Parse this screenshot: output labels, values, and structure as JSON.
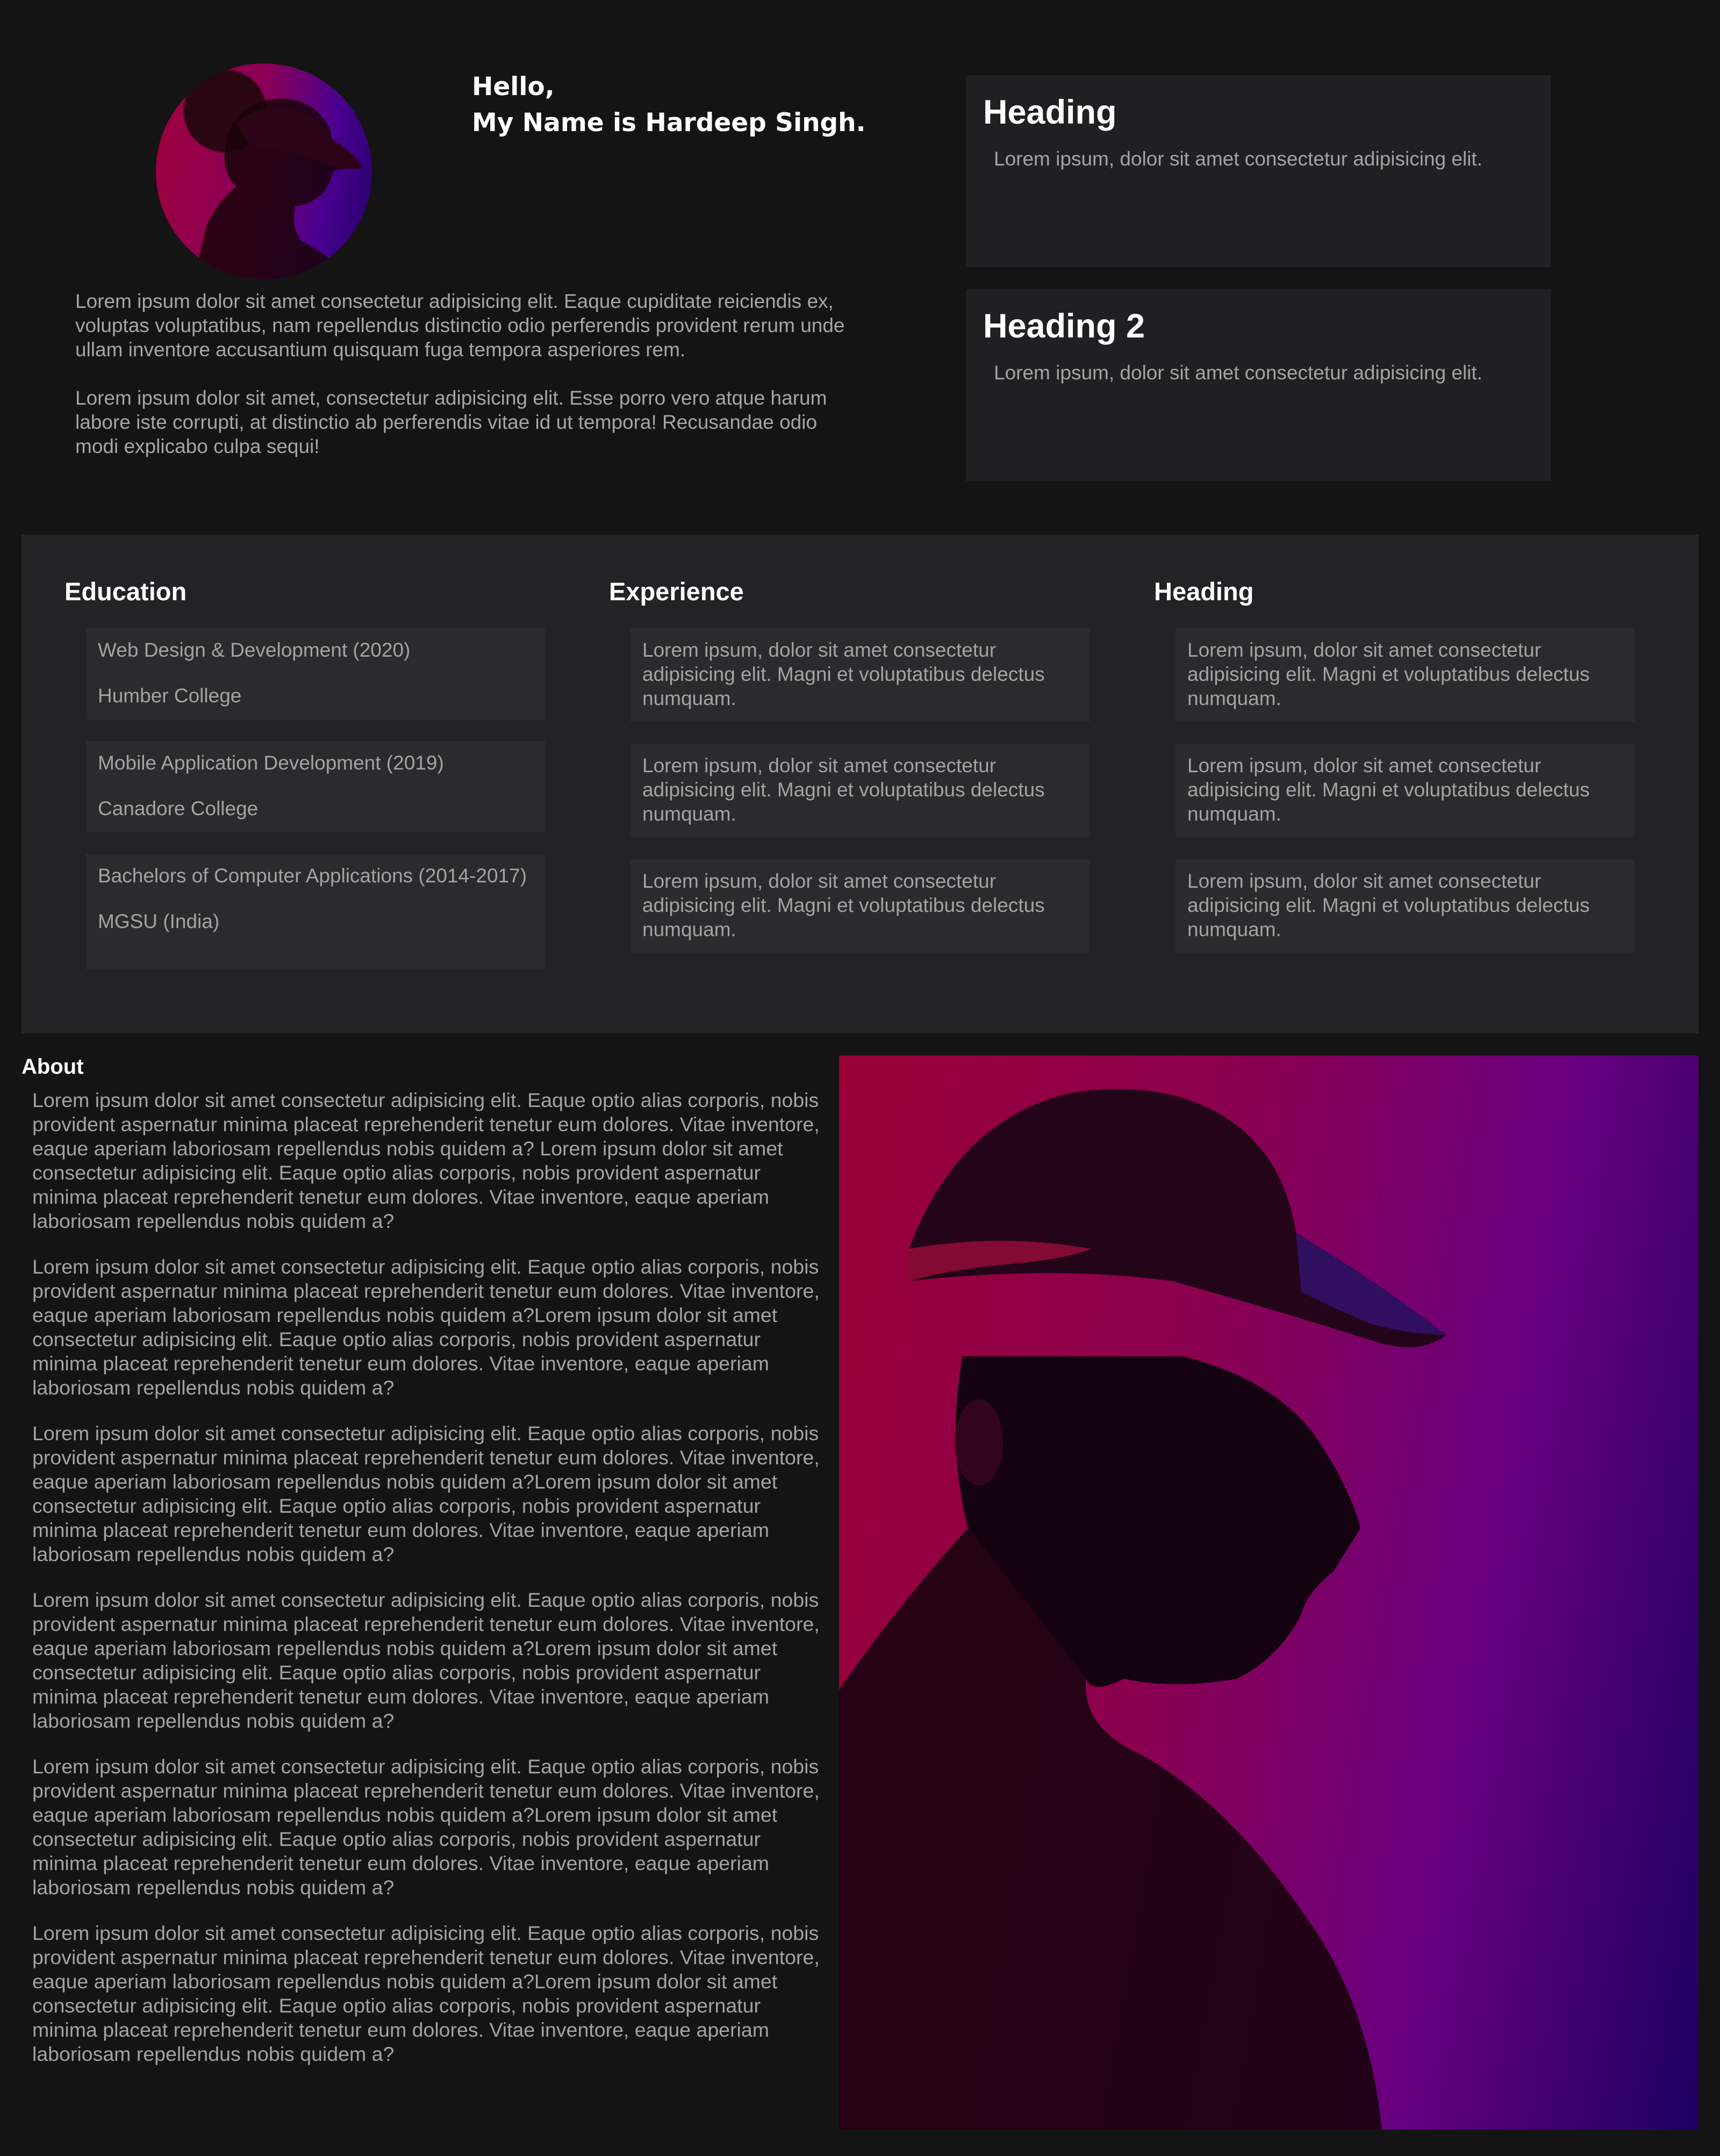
{
  "hero": {
    "greeting_line1": "Hello,",
    "greeting_line2": "My Name is Hardeep Singh.",
    "paragraphs": [
      "Lorem ipsum dolor sit amet consectetur adipisicing elit. Eaque cupiditate reiciendis ex, voluptas voluptatibus, nam repellendus distinctio odio perferendis provident rerum unde ullam inventore accusantium quisquam fuga tempora asperiores rem.",
      "Lorem ipsum dolor sit amet, consectetur adipisicing elit. Esse porro vero atque harum labore iste corrupti, at distinctio ab perferendis vitae id ut tempora! Recusandae odio modi explicabo culpa sequi!"
    ]
  },
  "cards": [
    {
      "heading": "Heading",
      "text": "Lorem ipsum, dolor sit amet consectetur adipisicing elit."
    },
    {
      "heading": "Heading 2",
      "text": "Lorem ipsum, dolor sit amet consectetur adipisicing elit."
    }
  ],
  "education": {
    "title": "Education",
    "items": [
      {
        "course": "Web Design & Development (2020)",
        "school": "Humber College"
      },
      {
        "course": "Mobile Application Development (2019)",
        "school": "Canadore College"
      },
      {
        "course": "Bachelors of Computer Applications (2014-2017)",
        "school": "MGSU (India)"
      }
    ]
  },
  "experience": {
    "title": "Experience",
    "items": [
      "Lorem ipsum, dolor sit amet consectetur adipisicing elit. Magni et voluptatibus delectus numquam.",
      "Lorem ipsum, dolor sit amet consectetur adipisicing elit. Magni et voluptatibus delectus numquam.",
      "Lorem ipsum, dolor sit amet consectetur adipisicing elit. Magni et voluptatibus delectus numquam."
    ]
  },
  "third_column": {
    "title": "Heading",
    "items": [
      "Lorem ipsum, dolor sit amet consectetur adipisicing elit. Magni et voluptatibus delectus numquam.",
      "Lorem ipsum, dolor sit amet consectetur adipisicing elit. Magni et voluptatibus delectus numquam.",
      "Lorem ipsum, dolor sit amet consectetur adipisicing elit. Magni et voluptatibus delectus numquam."
    ]
  },
  "about": {
    "title": "About",
    "paragraphs": [
      "Lorem ipsum dolor sit amet consectetur adipisicing elit. Eaque optio alias corporis, nobis provident aspernatur minima placeat reprehenderit tenetur eum dolores. Vitae inventore, eaque aperiam laboriosam repellendus nobis quidem a? Lorem ipsum dolor sit amet consectetur adipisicing elit. Eaque optio alias corporis, nobis provident aspernatur minima placeat reprehenderit tenetur eum dolores. Vitae inventore, eaque aperiam laboriosam repellendus nobis quidem a?",
      "Lorem ipsum dolor sit amet consectetur adipisicing elit. Eaque optio alias corporis, nobis provident aspernatur minima placeat reprehenderit tenetur eum dolores. Vitae inventore, eaque aperiam laboriosam repellendus nobis quidem a?Lorem ipsum dolor sit amet consectetur adipisicing elit. Eaque optio alias corporis, nobis provident aspernatur minima placeat reprehenderit tenetur eum dolores. Vitae inventore, eaque aperiam laboriosam repellendus nobis quidem a?",
      "Lorem ipsum dolor sit amet consectetur adipisicing elit. Eaque optio alias corporis, nobis provident aspernatur minima placeat reprehenderit tenetur eum dolores. Vitae inventore, eaque aperiam laboriosam repellendus nobis quidem a?Lorem ipsum dolor sit amet consectetur adipisicing elit. Eaque optio alias corporis, nobis provident aspernatur minima placeat reprehenderit tenetur eum dolores. Vitae inventore, eaque aperiam laboriosam repellendus nobis quidem a?",
      "Lorem ipsum dolor sit amet consectetur adipisicing elit. Eaque optio alias corporis, nobis provident aspernatur minima placeat reprehenderit tenetur eum dolores. Vitae inventore, eaque aperiam laboriosam repellendus nobis quidem a?Lorem ipsum dolor sit amet consectetur adipisicing elit. Eaque optio alias corporis, nobis provident aspernatur minima placeat reprehenderit tenetur eum dolores. Vitae inventore, eaque aperiam laboriosam repellendus nobis quidem a?",
      "Lorem ipsum dolor sit amet consectetur adipisicing elit. Eaque optio alias corporis, nobis provident aspernatur minima placeat reprehenderit tenetur eum dolores. Vitae inventore, eaque aperiam laboriosam repellendus nobis quidem a?Lorem ipsum dolor sit amet consectetur adipisicing elit. Eaque optio alias corporis, nobis provident aspernatur minima placeat reprehenderit tenetur eum dolores. Vitae inventore, eaque aperiam laboriosam repellendus nobis quidem a?",
      "Lorem ipsum dolor sit amet consectetur adipisicing elit. Eaque optio alias corporis, nobis provident aspernatur minima placeat reprehenderit tenetur eum dolores. Vitae inventore, eaque aperiam laboriosam repellendus nobis quidem a?Lorem ipsum dolor sit amet consectetur adipisicing elit. Eaque optio alias corporis, nobis provident aspernatur minima placeat reprehenderit tenetur eum dolores. Vitae inventore, eaque aperiam laboriosam repellendus nobis quidem a?"
    ]
  },
  "colors": {
    "background": "#141414",
    "card": "#202022",
    "band": "#232325",
    "accent_red": "#a0003c",
    "accent_purple": "#25006a"
  }
}
